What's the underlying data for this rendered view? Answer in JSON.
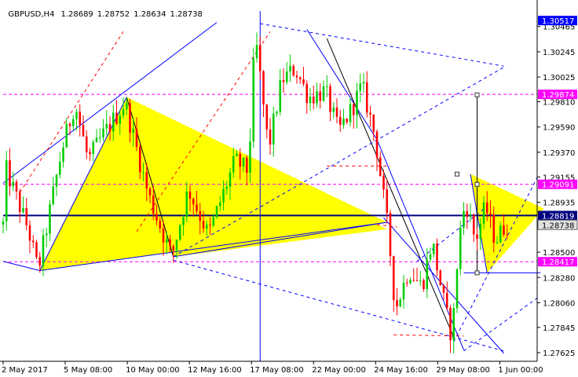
{
  "header": {
    "symbol": "GBPUSD,H4",
    "open": "1.28689",
    "high": "1.28752",
    "low": "1.28634",
    "close": "1.28738"
  },
  "colors": {
    "bull": "#00cc00",
    "bear": "#ff0000",
    "triangle_fill": "#ffff00",
    "trend_blue": "#0000ff",
    "dashed_red": "#ff0000",
    "magenta": "#ff00ff",
    "navy": "#000080",
    "tag_bg": "#0000ff",
    "tag_text": "#ffffff"
  },
  "chart_data": {
    "type": "candlestick",
    "symbol": "GBPUSD",
    "timeframe": "H4",
    "ylim": [
      1.2755,
      1.306
    ],
    "y_ticks": [
      "1.30465",
      "1.30245",
      "1.30025",
      "1.29810",
      "1.29590",
      "1.29370",
      "1.29155",
      "1.28935",
      "1.28500",
      "1.28280",
      "1.28060",
      "1.27845",
      "1.27625"
    ],
    "x_ticks": [
      "2 May 2017",
      "5 May 08:00",
      "10 May 00:00",
      "12 May 16:00",
      "17 May 08:00",
      "22 May 00:00",
      "24 May 16:00",
      "29 May 08:00",
      "1 Jun 00:00"
    ],
    "x_range": [
      0,
      160
    ],
    "price_tags": [
      {
        "label": "1.30517",
        "value": 1.30517
      },
      {
        "label": "1.29874",
        "value": 1.29874
      },
      {
        "label": "1.29091",
        "value": 1.29091
      },
      {
        "label": "1.28819",
        "value": 1.28819
      },
      {
        "label": "1.28738",
        "value": 1.28738
      },
      {
        "label": "1.28417",
        "value": 1.28417
      }
    ],
    "horizontal_levels": [
      {
        "value": 1.29874,
        "style": "dash",
        "color": "magenta"
      },
      {
        "value": 1.29091,
        "style": "dash",
        "color": "magenta"
      },
      {
        "value": 1.28417,
        "style": "dash",
        "color": "magenta"
      },
      {
        "value": 1.28819,
        "style": "solid",
        "color": "navy"
      }
    ],
    "vertical_markers": [
      {
        "x": 77,
        "color": "trend_blue"
      }
    ],
    "triangles": [
      {
        "points": [
          [
            11,
            1.2834
          ],
          [
            37,
            1.2985
          ],
          [
            115,
            1.2876
          ]
        ]
      },
      {
        "points": [
          [
            37,
            1.2985
          ],
          [
            51,
            1.2846
          ],
          [
            115,
            1.287
          ]
        ]
      },
      {
        "points": [
          [
            140,
            1.2918
          ],
          [
            162,
            1.2888
          ],
          [
            145,
            1.2832
          ]
        ]
      }
    ],
    "lines": [
      {
        "from": [
          0,
          1.291
        ],
        "to": [
          64,
          1.305
        ],
        "color": "trend_blue",
        "style": "solid"
      },
      {
        "from": [
          0,
          1.2842
        ],
        "to": [
          11,
          1.2834
        ],
        "color": "trend_blue",
        "style": "solid"
      },
      {
        "from": [
          11,
          1.2834
        ],
        "to": [
          37,
          1.2985
        ],
        "color": "trend_blue",
        "style": "solid"
      },
      {
        "from": [
          37,
          1.2985
        ],
        "to": [
          51,
          1.2846
        ],
        "color": "black",
        "style": "solid"
      },
      {
        "from": [
          51,
          1.2846
        ],
        "to": [
          115,
          1.2876
        ],
        "color": "trend_blue",
        "style": "solid"
      },
      {
        "from": [
          11,
          1.2834
        ],
        "to": [
          115,
          1.2876
        ],
        "color": "trend_blue",
        "style": "solid"
      },
      {
        "from": [
          91,
          1.3044
        ],
        "to": [
          112,
          1.2948
        ],
        "color": "trend_blue",
        "style": "solid"
      },
      {
        "from": [
          97,
          1.3036
        ],
        "to": [
          135,
          1.2776
        ],
        "color": "black",
        "style": "solid"
      },
      {
        "from": [
          112,
          1.2948
        ],
        "to": [
          138,
          1.2765
        ],
        "color": "trend_blue",
        "style": "solid"
      },
      {
        "from": [
          140,
          1.2918
        ],
        "to": [
          145,
          1.2832
        ],
        "color": "trend_blue",
        "style": "solid"
      },
      {
        "from": [
          114,
          1.288
        ],
        "to": [
          150,
          1.2762
        ],
        "color": "trend_blue",
        "style": "solid"
      },
      {
        "from": [
          40,
          1.2868
        ],
        "to": [
          80,
          1.3042
        ],
        "color": "dashed_red",
        "style": "dash"
      },
      {
        "from": [
          5,
          1.2902
        ],
        "to": [
          36,
          1.3042
        ],
        "color": "dashed_red",
        "style": "dash"
      },
      {
        "from": [
          51,
          1.2846
        ],
        "to": [
          150,
          1.3011
        ],
        "color": "trend_blue",
        "style": "dash"
      },
      {
        "from": [
          77,
          1.3049
        ],
        "to": [
          150,
          1.3012
        ],
        "color": "trend_blue",
        "style": "dash"
      },
      {
        "from": [
          51,
          1.2843
        ],
        "to": [
          150,
          1.2764
        ],
        "color": "trend_blue",
        "style": "dash"
      },
      {
        "from": [
          135,
          1.2772
        ],
        "to": [
          160,
          1.2915
        ],
        "color": "trend_blue",
        "style": "dash"
      },
      {
        "from": [
          138,
          1.2764
        ],
        "to": [
          160,
          1.281
        ],
        "color": "trend_blue",
        "style": "dash"
      },
      {
        "from": [
          124,
          1.2842
        ],
        "to": [
          145,
          1.289
        ],
        "color": "trend_blue",
        "style": "dash"
      },
      {
        "from": [
          97,
          1.2925
        ],
        "to": [
          116,
          1.2925
        ],
        "color": "dashed_red",
        "style": "dash"
      },
      {
        "from": [
          112,
          1.2874
        ],
        "to": [
          118,
          1.2872
        ],
        "color": "dashed_red",
        "style": "dash"
      },
      {
        "from": [
          117,
          1.2778
        ],
        "to": [
          138,
          1.2777
        ],
        "color": "dashed_red",
        "style": "dash"
      },
      {
        "from": [
          138,
          1.2832
        ],
        "to": [
          161,
          1.2832
        ],
        "color": "trend_blue",
        "style": "solid"
      },
      {
        "from": [
          142,
          1.2987
        ],
        "to": [
          142,
          1.2832
        ],
        "color": "black",
        "style": "solid"
      }
    ],
    "markers": [
      {
        "x": 142,
        "y": 1.2987
      },
      {
        "x": 142,
        "y": 1.2909
      },
      {
        "x": 142,
        "y": 1.2832
      },
      {
        "x": 136,
        "y": 1.2918
      }
    ],
    "pivots": [
      {
        "x": 1,
        "y": 1.2925
      },
      {
        "x": 8,
        "y": 1.287
      },
      {
        "x": 11,
        "y": 1.2834
      },
      {
        "x": 18,
        "y": 1.2938
      },
      {
        "x": 22,
        "y": 1.298
      },
      {
        "x": 26,
        "y": 1.293
      },
      {
        "x": 30,
        "y": 1.295
      },
      {
        "x": 37,
        "y": 1.298
      },
      {
        "x": 44,
        "y": 1.29
      },
      {
        "x": 51,
        "y": 1.2846
      },
      {
        "x": 56,
        "y": 1.2905
      },
      {
        "x": 62,
        "y": 1.2865
      },
      {
        "x": 70,
        "y": 1.293
      },
      {
        "x": 74,
        "y": 1.292
      },
      {
        "x": 76,
        "y": 1.304
      },
      {
        "x": 80,
        "y": 1.294
      },
      {
        "x": 84,
        "y": 1.3
      },
      {
        "x": 88,
        "y": 1.301
      },
      {
        "x": 92,
        "y": 1.2985
      },
      {
        "x": 97,
        "y": 1.299
      },
      {
        "x": 101,
        "y": 1.2955
      },
      {
        "x": 105,
        "y": 1.2975
      },
      {
        "x": 108,
        "y": 1.2995
      },
      {
        "x": 112,
        "y": 1.295
      },
      {
        "x": 116,
        "y": 1.2865
      },
      {
        "x": 118,
        "y": 1.28
      },
      {
        "x": 122,
        "y": 1.2835
      },
      {
        "x": 126,
        "y": 1.282
      },
      {
        "x": 129,
        "y": 1.286
      },
      {
        "x": 133,
        "y": 1.28
      },
      {
        "x": 135,
        "y": 1.2775
      },
      {
        "x": 137,
        "y": 1.286
      },
      {
        "x": 139,
        "y": 1.2895
      },
      {
        "x": 142,
        "y": 1.286
      },
      {
        "x": 145,
        "y": 1.289
      },
      {
        "x": 148,
        "y": 1.286
      },
      {
        "x": 151,
        "y": 1.2874
      }
    ]
  }
}
